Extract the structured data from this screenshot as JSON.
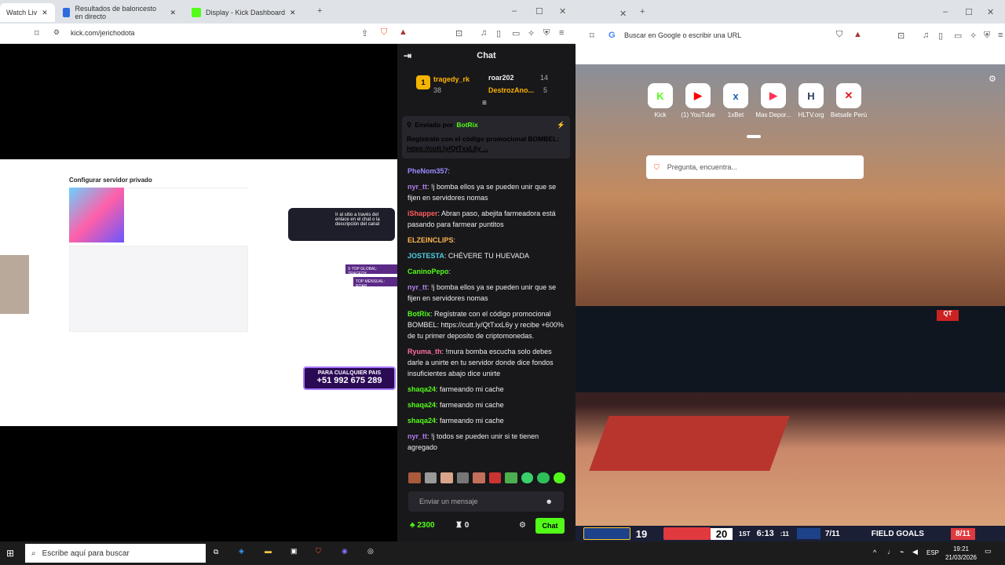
{
  "left_browser": {
    "tabs": [
      {
        "label": "Watch Liv",
        "color": "#53fc18"
      },
      {
        "label": "Resultados de baloncesto en directo",
        "color": "#2d6cdf"
      },
      {
        "label": "Display - Kick Dashboard",
        "color": "#53fc18"
      }
    ],
    "url": "kick.com/jerichodota"
  },
  "stream_overlay": {
    "panel_title": "Configurar servidor privado",
    "promo_text": "PARA CUALQUIER PAIS",
    "promo_phone": "+51 992 675 289",
    "side_note": "Ir al sitio a través del enlace en el chat o la descripción del canal",
    "tags": [
      "S TOP GLOBAL: TRAGEDY",
      "TOP MENSUAL: ROAR"
    ]
  },
  "chat": {
    "title": "Chat",
    "leaderboard": [
      {
        "rank": "1",
        "name": "tragedy_rk",
        "count": "38"
      },
      {
        "name": "roar202",
        "count": "14"
      },
      {
        "name": "DestrozAno...",
        "count": "5"
      }
    ],
    "pinned": {
      "sent_by": "Enviado por",
      "user": "BotRix",
      "text": "Regístrate con el código promocional BOMBEL:",
      "link": "https://cutt.ly/QtTxxL6y ..."
    },
    "messages": [
      {
        "user": "PheNom357",
        "color": "#9a8cff",
        "text": ""
      },
      {
        "user": "nyr_tt",
        "color": "#b37feb",
        "text": "!j bomba ellos ya se pueden unir que se fijen en servidores nomas"
      },
      {
        "user": "iShapper",
        "color": "#ff5c5c",
        "text": "Abran paso, abejita farmeadora está pasando para farmear puntitos"
      },
      {
        "user": "ELZEINCLIPS",
        "color": "#ffb74d",
        "text": ""
      },
      {
        "user": "JOSTESTA",
        "color": "#4dd0e1",
        "text": "CHÉVERE TU HUEVADA"
      },
      {
        "user": "CaninoPepo",
        "color": "#53fc18",
        "text": ""
      },
      {
        "user": "nyr_tt",
        "color": "#b37feb",
        "text": "!j bomba ellos ya se pueden unir que se fijen en servidores nomas"
      },
      {
        "user": "BotRix",
        "color": "#53fc18",
        "text": "Regístrate con el código promocional BOMBEL: https://cutt.ly/QtTxxL6y y recibe +600% de tu primer deposito de criptomonedas."
      },
      {
        "user": "Ryuma_th",
        "color": "#ff6f9c",
        "text": "!mura bomba escucha solo debes darle a unirte en tu servidor donde dice fondos insuficientes abajo dice unirte"
      },
      {
        "user": "shaqa24",
        "color": "#53fc18",
        "text": "farmeando mi cache"
      },
      {
        "user": "shaqa24",
        "color": "#53fc18",
        "text": "farmeando mi cache"
      },
      {
        "user": "shaqa24",
        "color": "#53fc18",
        "text": "farmeando mi cache"
      },
      {
        "user": "nyr_tt",
        "color": "#b37feb",
        "text": "!j todos se pueden unir si te tienen agregado"
      }
    ],
    "input_placeholder": "Enviar un mensaje",
    "points": "2300",
    "other_count": "0",
    "send_label": "Chat"
  },
  "right_browser": {
    "url_placeholder": "Buscar en Google o escribir una URL",
    "search_placeholder": "Pregunta, encuentra...",
    "shortcuts": [
      {
        "label": "Kick",
        "color": "#53fc18",
        "glyph": "K"
      },
      {
        "label": "(1) YouTube",
        "color": "#ff0000",
        "glyph": "▶"
      },
      {
        "label": "1xBet",
        "color": "#1a5fb4",
        "glyph": "x"
      },
      {
        "label": "Mas Depor...",
        "color": "#ff3355",
        "glyph": "▶"
      },
      {
        "label": "HLTV.org",
        "color": "#2a3f5f",
        "glyph": "H"
      },
      {
        "label": "Betsafe Perú",
        "color": "#e01b24",
        "glyph": "✕"
      }
    ]
  },
  "scoreboard": {
    "away_score": "19",
    "home_score": "20",
    "period": "1ST",
    "clock": "6:13",
    "shot_clock": ":11",
    "stat_left": "7/11",
    "stat_label": "FIELD GOALS",
    "stat_right": "8/11"
  },
  "taskbar": {
    "search_placeholder": "Escribe aquí para buscar",
    "lang": "ESP",
    "time": "19:21",
    "date": "21/03/2026"
  }
}
